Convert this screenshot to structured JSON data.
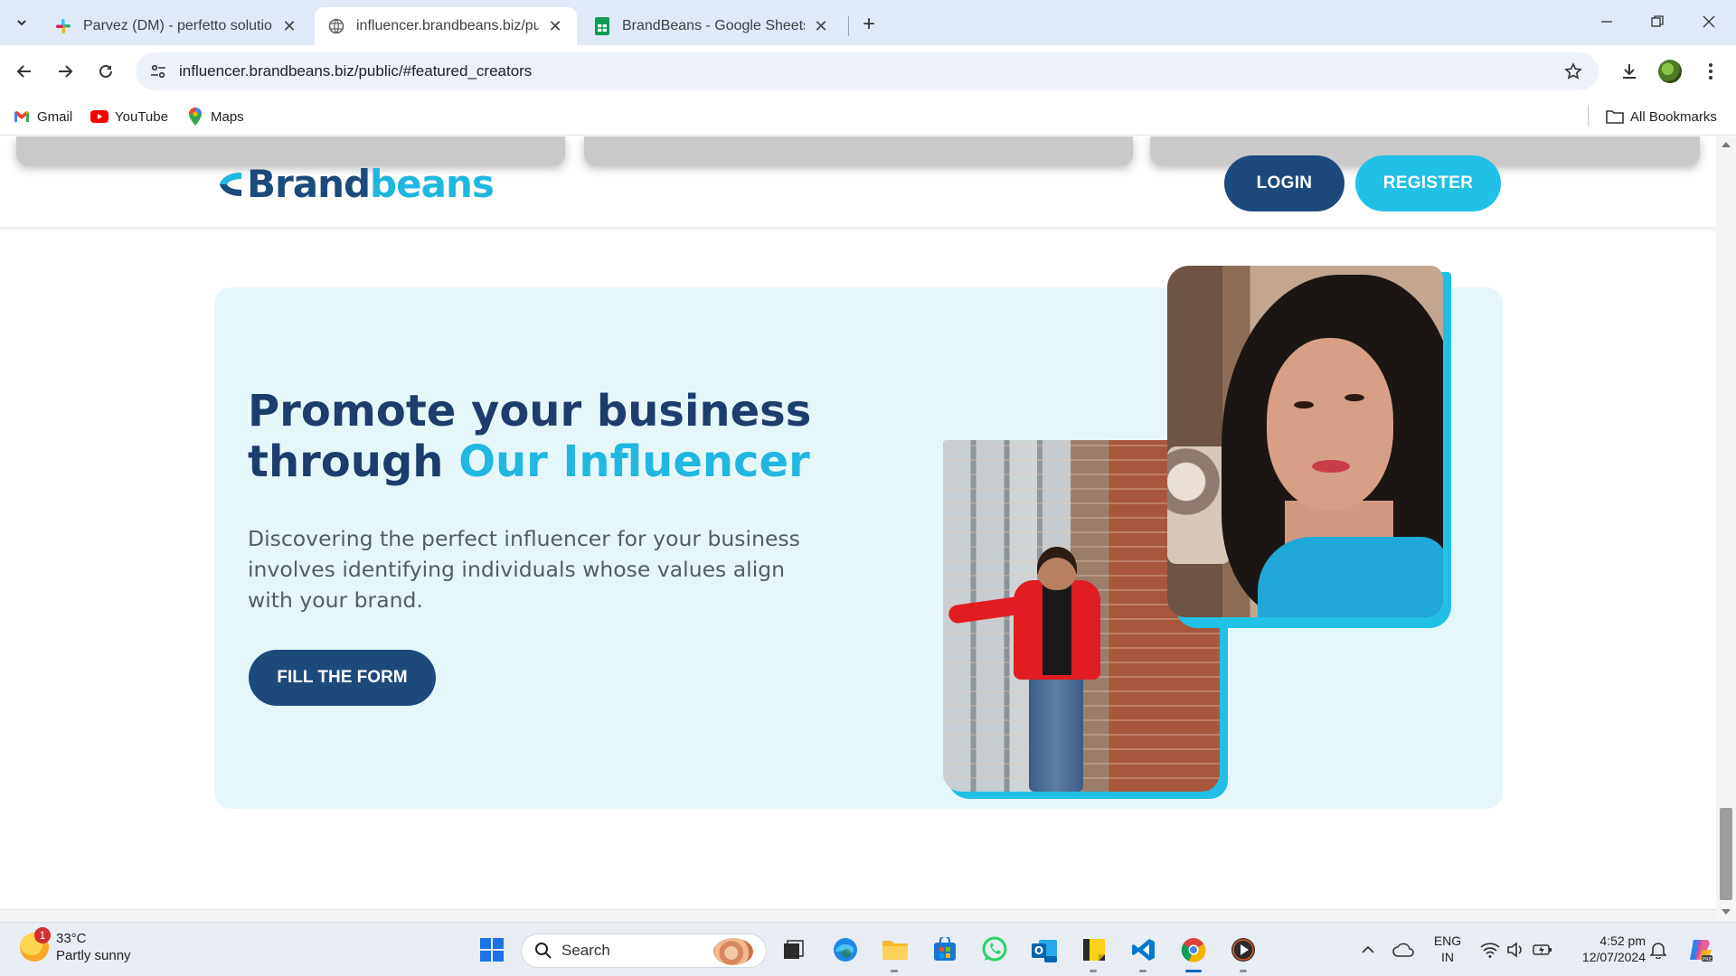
{
  "browser": {
    "tabs": [
      {
        "title": "Parvez (DM) - perfetto solutions",
        "active": false
      },
      {
        "title": "influencer.brandbeans.biz/public/#featured_creators",
        "active": true
      },
      {
        "title": "BrandBeans - Google Sheets",
        "active": false
      }
    ],
    "url": "influencer.brandbeans.biz/public/#featured_creators",
    "bookmarks": [
      {
        "label": "Gmail",
        "icon": "gmail-icon"
      },
      {
        "label": "YouTube",
        "icon": "youtube-icon"
      },
      {
        "label": "Maps",
        "icon": "maps-icon"
      }
    ],
    "all_bookmarks": "All Bookmarks"
  },
  "site": {
    "logo": {
      "brand": "Brand",
      "beans": "beans"
    },
    "login": "LOGIN",
    "register": "REGISTER",
    "hero": {
      "title_line1": "Promote your business",
      "title_line2_plain": "through ",
      "title_line2_accent": "Our Influencer",
      "description": "Discovering the perfect influencer for your business involves identifying individuals whose values align with your brand.",
      "cta": "FILL THE FORM"
    },
    "colors": {
      "navy": "#1c4a7c",
      "cyan": "#21c0e6",
      "hero_bg": "#e6f7fc"
    }
  },
  "taskbar": {
    "weather": {
      "temp": "33°C",
      "condition": "Partly sunny",
      "badge": "1"
    },
    "search_label": "Search",
    "language": {
      "line1": "ENG",
      "line2": "IN"
    },
    "time": "4:52 pm",
    "date": "12/07/2024"
  }
}
